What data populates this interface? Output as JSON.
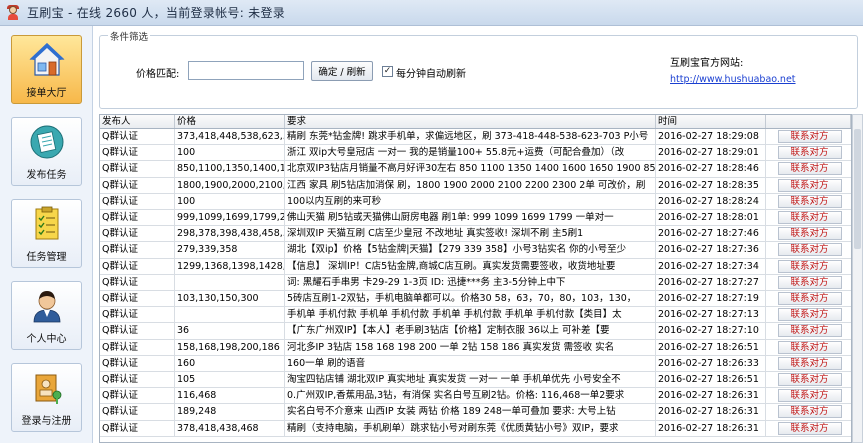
{
  "window": {
    "title": "互刷宝 - 在线 2660 人，当前登录帐号: 未登录"
  },
  "sidebar": {
    "items": [
      {
        "label": "接单大厅",
        "icon": "house-icon"
      },
      {
        "label": "发布任务",
        "icon": "paper-icon"
      },
      {
        "label": "任务管理",
        "icon": "checklist-icon"
      },
      {
        "label": "个人中心",
        "icon": "user-icon"
      },
      {
        "label": "登录与注册",
        "icon": "login-key-icon"
      }
    ]
  },
  "filter": {
    "legend": "条件筛选",
    "price_label": "价格匹配:",
    "price_value": "",
    "refresh_button": "确定 / 刷新",
    "auto_refresh_label": "每分钟自动刷新",
    "auto_refresh_checked": "✓",
    "site_label": "互刷宝官方网站:",
    "site_link": "http://www.hushuabao.net"
  },
  "grid": {
    "headers": [
      "发布人",
      "价格",
      "要求",
      "时间",
      ""
    ],
    "contact_label": "联系对方",
    "rows": [
      {
        "publisher": "Q群认证",
        "price": "373,418,448,538,623,...",
        "req": "精刷 东莞*钻金牌! 跳求手机单，求偏远地区，刷 373-418-448-538-623-703 P小号",
        "time": "2016-02-27 18:29:08"
      },
      {
        "publisher": "Q群认证",
        "price": "100",
        "req": "浙江 双ip大号皇冠店 一对一  我的是销量100+ 55.8元+运费（可配合叠加）（改",
        "time": "2016-02-27 18:29:01"
      },
      {
        "publisher": "Q群认证",
        "price": "850,1100,1350,1400,1...",
        "req": "北京双IP3钻店月销量不高月好评30左右 850 1100 1350 1400 1600 1650 1900 850",
        "time": "2016-02-27 18:28:46"
      },
      {
        "publisher": "Q群认证",
        "price": "1800,1900,2000,2100,...",
        "req": "江西 家具 刷5钻店加消保 刷，1800 1900 2000 2100 2200 2300 2单 可改价，刷",
        "time": "2016-02-27 18:28:35"
      },
      {
        "publisher": "Q群认证",
        "price": "100",
        "req": "100以内互刷的来可秒",
        "time": "2016-02-27 18:28:24"
      },
      {
        "publisher": "Q群认证",
        "price": "999,1099,1699,1799,200",
        "req": "佛山天猫   刷5钻或天猫佛山厨房电器  刷1单:    999  1099  1699  1799 一单对一",
        "time": "2016-02-27 18:28:01"
      },
      {
        "publisher": "Q群认证",
        "price": "298,378,398,438,458,...",
        "req": "深圳双IP  天猫互刷  C店至少皇冠     不改地址  真实签收!  深圳不刷  主5刷1",
        "time": "2016-02-27 18:27:46"
      },
      {
        "publisher": "Q群认证",
        "price": "279,339,358",
        "req": "湖北【双ip】价格【5钻金牌|天猫】【279 339 358】小号3钻实名 你的小号至少",
        "time": "2016-02-27 18:27:36"
      },
      {
        "publisher": "Q群认证",
        "price": "1299,1368,1398,1428,...",
        "req": "【信息】 深圳IP！C店5钻金牌,商城C店互刷。真实发货需要签收，收货地址要",
        "time": "2016-02-27 18:27:34"
      },
      {
        "publisher": "Q群认证",
        "price": "",
        "req": "词: 黑耀石手串男  卡29-29    1-3页  ID: 迅捷***务  主3-5分钟上中下",
        "time": "2016-02-27 18:27:27"
      },
      {
        "publisher": "Q群认证",
        "price": "103,130,150,300",
        "req": "5砖店互刷1-2双钻，手机电脑单都可以。价格30 58，63，70，80，103，130，",
        "time": "2016-02-27 18:27:19"
      },
      {
        "publisher": "Q群认证",
        "price": "",
        "req": "手机单 手机付款 手机单 手机付款 手机单 手机付款 手机单 手机付款【类目】太",
        "time": "2016-02-27 18:27:13"
      },
      {
        "publisher": "Q群认证",
        "price": "36",
        "req": "【广东广州双IP】【本人】老手刷3钻店【价格】定制衣服 36以上 可补差【要",
        "time": "2016-02-27 18:27:10"
      },
      {
        "publisher": "Q群认证",
        "price": "158,168,198,200,186",
        "req": "河北多IP  3钻店  158  168  198  200 一单  2钻  158  186  真实发货  需签收  实名",
        "time": "2016-02-27 18:26:51"
      },
      {
        "publisher": "Q群认证",
        "price": "160",
        "req": "160一单  刷的语音",
        "time": "2016-02-27 18:26:33"
      },
      {
        "publisher": "Q群认证",
        "price": "105",
        "req": "淘宝四钻店铺 湖北双IP 真实地址 真实发货 一对一 一单 手机单优先 小号安全不",
        "time": "2016-02-27 18:26:51"
      },
      {
        "publisher": "Q群认证",
        "price": "116,468",
        "req": "0.广州双IP,香蕉用品,3钻，有消保 实名白号互刷2钻。价格: 116,468一单2要求",
        "time": "2016-02-27 18:26:31"
      },
      {
        "publisher": "Q群认证",
        "price": "189,248",
        "req": "实名白号不介意来 山西IP 女装 两钻 价格 189 248一单可叠加 要求: 大号上钻",
        "time": "2016-02-27 18:26:31"
      },
      {
        "publisher": "Q群认证",
        "price": "378,418,438,468",
        "req": "精刷（支持电脑，手机刷单）跳求钻小号对刷东莞《优质黄钻小号》双IP，要求",
        "time": "2016-02-27 18:26:31"
      }
    ]
  }
}
